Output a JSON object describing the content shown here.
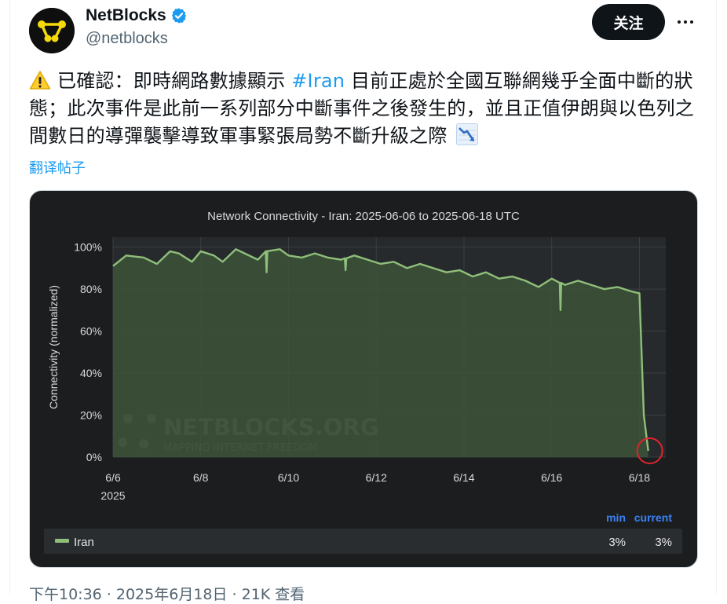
{
  "author": {
    "name": "NetBlocks",
    "handle": "@netblocks",
    "verified_icon": "verified-badge-icon",
    "follow_label": "关注"
  },
  "post": {
    "text_before_hashtag": "已確認：即時網路數據顯示 ",
    "hashtag": "#Iran",
    "text_after_hashtag": " 目前正處於全國互聯網幾乎全面中斷的狀態；此次事件是此前一系列部分中斷事件之後發生的，並且正值伊朗與以色列之間數日的導彈襲擊導致軍事緊張局勢不斷升級之際",
    "translate_label": "翻译帖子",
    "timestamp": "下午10:36 · 2025年6月18日 · 21K 查看"
  },
  "chart_data": {
    "type": "area",
    "title": "Network Connectivity - Iran: 2025-06-06 to 2025-06-18 UTC",
    "ylabel": "Connectivity (normalized)",
    "ylim": [
      0,
      100
    ],
    "yticks": [
      "0%",
      "20%",
      "40%",
      "60%",
      "80%",
      "100%"
    ],
    "xticks": [
      "6/6",
      "6/8",
      "6/10",
      "6/12",
      "6/14",
      "6/16",
      "6/18"
    ],
    "xtick_year": "2025",
    "watermark": "NETBLOCKS.ORG MAPPING INTERNET FREEDOM",
    "series": [
      {
        "name": "Iran",
        "color": "#8fbf7a",
        "x_days": [
          0,
          0.3,
          0.7,
          1.0,
          1.3,
          1.5,
          1.8,
          2.0,
          2.3,
          2.5,
          2.8,
          3.0,
          3.3,
          3.5,
          3.8,
          4.0,
          4.3,
          4.6,
          4.9,
          5.2,
          5.5,
          5.8,
          6.1,
          6.4,
          6.7,
          7.0,
          7.3,
          7.6,
          7.9,
          8.2,
          8.5,
          8.8,
          9.1,
          9.4,
          9.7,
          10.0,
          10.3,
          10.6,
          10.9,
          11.2,
          11.5,
          11.8,
          12.0,
          12.1,
          12.2
        ],
        "values": [
          91,
          96,
          95,
          92,
          98,
          97,
          93,
          98,
          96,
          93,
          99,
          97,
          94,
          98,
          99,
          96,
          95,
          97,
          95,
          94,
          96,
          94,
          92,
          93,
          90,
          92,
          90,
          88,
          89,
          86,
          88,
          85,
          86,
          84,
          81,
          85,
          82,
          84,
          82,
          80,
          81,
          79,
          78,
          20,
          3
        ]
      }
    ],
    "dips": [
      {
        "x_day": 3.5,
        "value": 88
      },
      {
        "x_day": 5.3,
        "value": 89
      },
      {
        "x_day": 10.2,
        "value": 70
      }
    ],
    "legend": {
      "min_label": "min",
      "current_label": "current",
      "rows": [
        {
          "name": "Iran",
          "min": "3%",
          "current": "3%"
        }
      ]
    }
  }
}
